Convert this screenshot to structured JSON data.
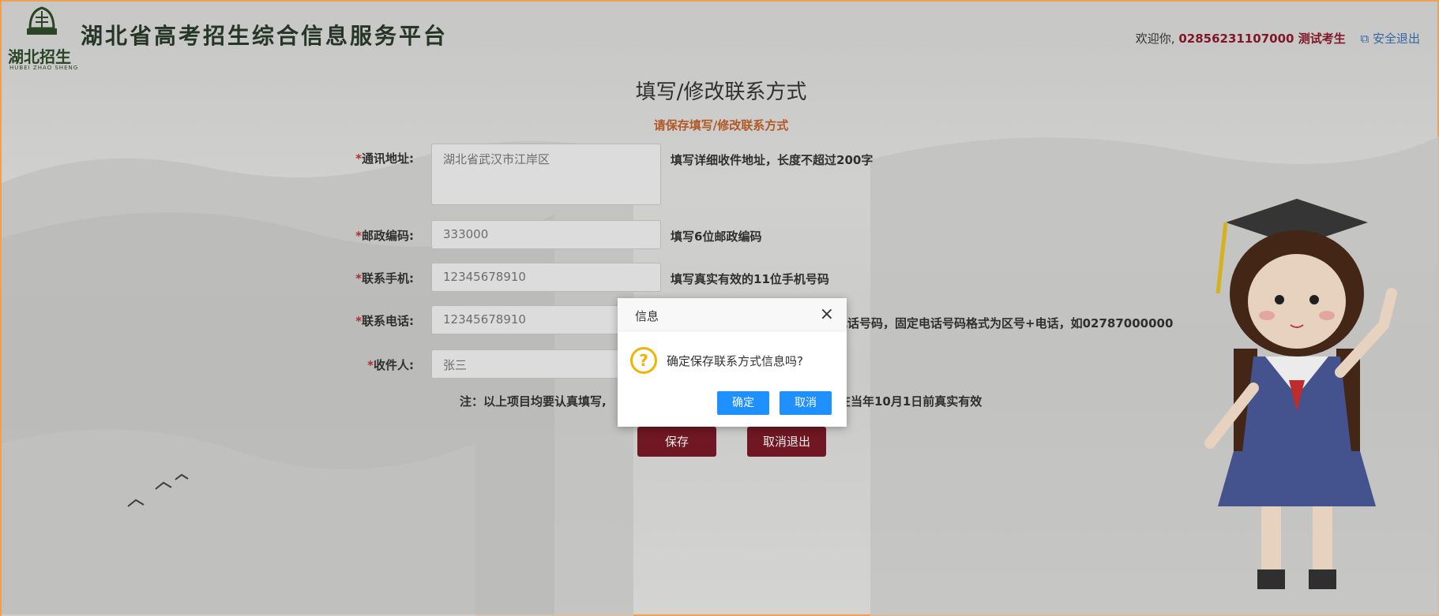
{
  "header": {
    "logo_text": "湖北招生",
    "logo_sub": "HUBEI ZHAO SHENG",
    "site_title": "湖北省高考招生综合信息服务平台",
    "welcome_prefix": "欢迎你,",
    "user_id": "02856231107000 测试考生",
    "logout_label": "安全退出"
  },
  "form": {
    "title": "填写/修改联系方式",
    "hint": "请保存填写/修改联系方式",
    "fields": [
      {
        "label": "通讯地址:",
        "value": "湖北省武汉市江岸区",
        "desc": "填写详细收件地址，长度不超过200字"
      },
      {
        "label": "邮政编码:",
        "value": "333000",
        "desc": "填写6位邮政编码"
      },
      {
        "label": "联系手机:",
        "value": "12345678910",
        "desc": "填写真实有效的11位手机号码"
      },
      {
        "label": "联系电话:",
        "value": "12345678910",
        "desc": "电话号码，固定电话号码格式为区号+电话，如02787000000"
      },
      {
        "label": "收件人:",
        "value": "张三",
        "desc": ""
      }
    ],
    "note_left": "注：以上项目均要认真填写,",
    "note_right": "在当年10月1日前真实有效",
    "save_label": "保存",
    "cancel_label": "取消退出"
  },
  "dialog": {
    "title": "信息",
    "message": "确定保存联系方式信息吗?",
    "ok_label": "确定",
    "cancel_label": "取消",
    "icon": "question-icon"
  },
  "colors": {
    "accent": "#7a1a26",
    "dialog_button": "#1e90ff",
    "hint": "#c0602a"
  }
}
